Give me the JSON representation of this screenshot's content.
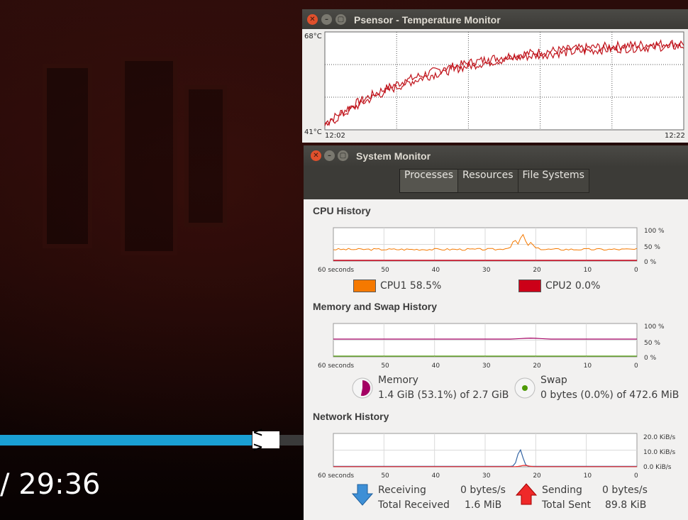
{
  "player": {
    "time_text": "/ 29:36",
    "seek_handle": "< >",
    "progress": 0.83,
    "progress_color": "#1aa0d4"
  },
  "psensor": {
    "title": "Psensor - Temperature Monitor",
    "ymax_label": "68°C",
    "ymin_label": "41°C",
    "x_start_label": "12:02",
    "x_end_label": "12:22",
    "line_color": "#c0141c",
    "buttons": [
      "close-icon",
      "minimize-icon",
      "maximize-icon"
    ]
  },
  "sysmon": {
    "title": "System Monitor",
    "tabs": [
      {
        "label": "Processes",
        "active": true
      },
      {
        "label": "Resources",
        "active": false
      },
      {
        "label": "File Systems",
        "active": false
      }
    ],
    "x_ticks": [
      "60 seconds",
      "50",
      "40",
      "30",
      "20",
      "10",
      "0"
    ],
    "cpu": {
      "title": "CPU History",
      "y_ticks": [
        "100 %",
        "50 %",
        "0 %"
      ],
      "legend": [
        {
          "label": "CPU1",
          "value": "58.5%",
          "color": "#f57900"
        },
        {
          "label": "CPU2",
          "value": "0.0%",
          "color": "#cc0018"
        }
      ]
    },
    "memory": {
      "title": "Memory and Swap History",
      "y_ticks": [
        "100 %",
        "50 %",
        "0 %"
      ],
      "memory_label": "Memory",
      "memory_value": "1.4 GiB (53.1%) of 2.7 GiB",
      "swap_label": "Swap",
      "swap_value": "0 bytes (0.0%) of 472.6 MiB",
      "memory_color": "#a40063",
      "swap_color": "#4e9a06",
      "memory_fraction": 0.531,
      "swap_fraction": 0.0
    },
    "network": {
      "title": "Network History",
      "y_ticks": [
        "20.0 KiB/s",
        "10.0 KiB/s",
        "0.0 KiB/s"
      ],
      "receiving_label": "Receiving",
      "receiving_value": "0 bytes/s",
      "total_received_label": "Total Received",
      "total_received_value": "1.6 MiB",
      "sending_label": "Sending",
      "sending_value": "0 bytes/s",
      "total_sent_label": "Total Sent",
      "total_sent_value": "89.8 KiB",
      "receive_color": "#3465a4",
      "send_color": "#ef2929"
    }
  }
}
